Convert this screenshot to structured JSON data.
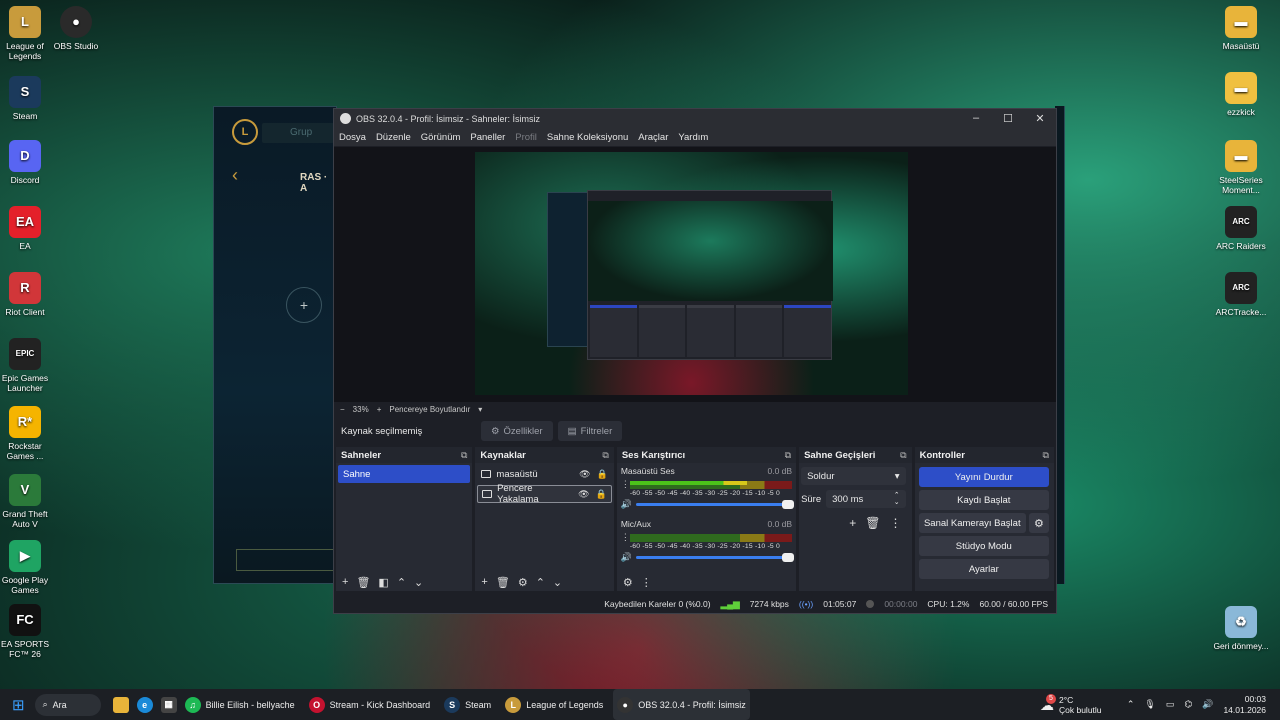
{
  "desktop": {
    "left_icons": [
      {
        "label": "League of Legends",
        "color": "#c89b3c",
        "glyph": "L"
      },
      {
        "label": "Steam",
        "color": "#1b3a5c",
        "glyph": "S"
      },
      {
        "label": "Discord",
        "color": "#5865f2",
        "glyph": "D"
      },
      {
        "label": "EA",
        "color": "#e4202a",
        "glyph": "EA"
      },
      {
        "label": "Riot Client",
        "color": "#d13639",
        "glyph": "R"
      },
      {
        "label": "Epic Games Launcher",
        "color": "#222222",
        "glyph": "EPIC"
      },
      {
        "label": "Rockstar Games ...",
        "color": "#f5b400",
        "glyph": "R*"
      },
      {
        "label": "Grand Theft Auto V",
        "color": "#2b7a3a",
        "glyph": "V"
      },
      {
        "label": "Google Play Games",
        "color": "#1fa463",
        "glyph": "▶"
      },
      {
        "label": "EA SPORTS FC™ 26",
        "color": "#111111",
        "glyph": "FC"
      }
    ],
    "second_col_icon": {
      "label": "OBS Studio",
      "glyph": "●"
    },
    "right_icons": [
      {
        "label": "Masaüstü",
        "color": "#e8b43a",
        "glyph": "▬"
      },
      {
        "label": "ezzkick",
        "color": "#f0c040",
        "glyph": "▬"
      },
      {
        "label": "SteelSeries Moment...",
        "color": "#e8b43a",
        "glyph": "▬"
      },
      {
        "label": "ARC Raiders",
        "color": "#222222",
        "glyph": "ARC"
      },
      {
        "label": "ARCTracke...",
        "color": "#222222",
        "glyph": "ARC"
      },
      {
        "label": "Geri dönmey...",
        "color": "#8ab8d8",
        "glyph": "♻"
      }
    ]
  },
  "lol_window": {
    "group_placeholder": "Grup",
    "ras_label": "RAS · A"
  },
  "obs": {
    "title": "OBS 32.0.4 - Profil: İsimsiz - Sahneler: İsimsiz",
    "menu": [
      "Dosya",
      "Düzenle",
      "Görünüm",
      "Paneller",
      "Profil",
      "Sahne Koleksiyonu",
      "Araçlar",
      "Yardım"
    ],
    "menu_disabled": "Profil",
    "zoom": {
      "minus": "−",
      "value": "33%",
      "plus": "+",
      "fit_label": "Pencereye Boyutlandır"
    },
    "source_bar": {
      "status": "Kaynak seçilmemiş",
      "properties": "Özellikler",
      "filters": "Filtreler"
    },
    "scenes": {
      "title": "Sahneler",
      "items": [
        "Sahne"
      ]
    },
    "sources": {
      "title": "Kaynaklar",
      "items": [
        {
          "name": "masaüstü",
          "selected": false
        },
        {
          "name": "Pencere Yakalama",
          "selected": true
        }
      ]
    },
    "mixer": {
      "title": "Ses Karıştırıcı",
      "channels": [
        {
          "name": "Masaüstü Ses",
          "db": "0.0 dB",
          "level": 0.72
        },
        {
          "name": "Mic/Aux",
          "db": "0.0 dB",
          "level": 0.0
        }
      ],
      "ticks": "-60 -55 -50 -45 -40 -35 -30 -25 -20 -15 -10 -5 0"
    },
    "transitions": {
      "title": "Sahne Geçişleri",
      "type": "Soldur",
      "duration_label": "Süre",
      "duration": "300 ms"
    },
    "controls": {
      "title": "Kontroller",
      "stop_stream": "Yayını Durdur",
      "start_record": "Kaydı Başlat",
      "virtual_cam": "Sanal Kamerayı Başlat",
      "studio_mode": "Stüdyo Modu",
      "settings": "Ayarlar"
    },
    "status": {
      "dropped": "Kaybedilen Kareler 0 (%0.0)",
      "bitrate": "7274 kbps",
      "live_time": "01:05:07",
      "rec_time": "00:00:00",
      "cpu": "CPU: 1.2%",
      "fps": "60.00 / 60.00 FPS"
    }
  },
  "taskbar": {
    "search": "Ara",
    "items": [
      {
        "label": "Billie Eilish - bellyache",
        "color": "#1db954",
        "glyph": "♫"
      },
      {
        "label": "Stream - Kick Dashboard",
        "color": "#c4122f",
        "glyph": "O"
      },
      {
        "label": "Steam",
        "color": "#1b3a5c",
        "glyph": "S"
      },
      {
        "label": "League of Legends",
        "color": "#c89b3c",
        "glyph": "L"
      },
      {
        "label": "OBS 32.0.4 - Profil: İsimsiz",
        "color": "#333333",
        "glyph": "●"
      }
    ],
    "weather_temp": "2°C",
    "weather_desc": "Çok bulutlu",
    "weather_badge": "5",
    "time": "00:03",
    "date": "14.01.2026"
  }
}
